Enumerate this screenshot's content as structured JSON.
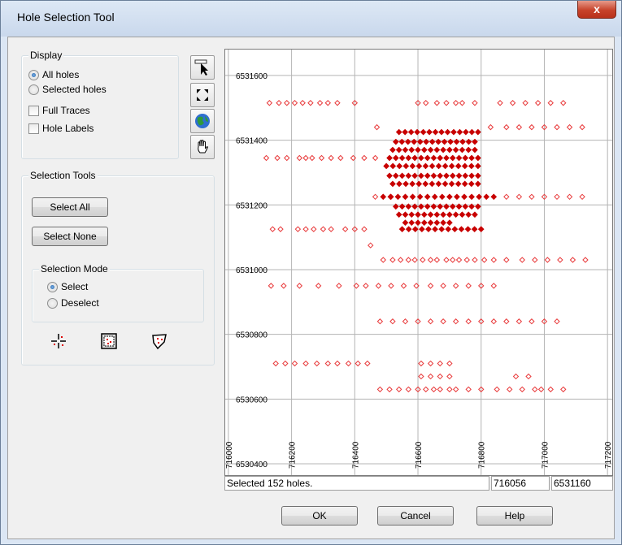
{
  "window": {
    "title": "Hole Selection Tool",
    "close_symbol": "x"
  },
  "display": {
    "title": "Display",
    "option_all": "All holes",
    "option_selected": "Selected holes",
    "selected_option": "All holes",
    "full_traces_label": "Full Traces",
    "full_traces_checked": false,
    "hole_labels_label": "Hole Labels",
    "hole_labels_checked": false
  },
  "toolbar": {
    "icons": [
      "pointer-icon",
      "zoom-extents-icon",
      "globe-icon",
      "pan-hand-icon"
    ]
  },
  "selection_tools": {
    "title": "Selection Tools",
    "select_all_label": "Select All",
    "select_none_label": "Select None",
    "mode_title": "Selection Mode",
    "mode_select": "Select",
    "mode_deselect": "Deselect",
    "mode_value": "Select",
    "icons": [
      "point-select-icon",
      "box-select-icon",
      "polygon-select-icon"
    ]
  },
  "chart_data": {
    "type": "scatter",
    "x_ticks": [
      "716000",
      "716200",
      "716400",
      "716600",
      "716800",
      "717000",
      "717200"
    ],
    "y_ticks": [
      "6531600",
      "6531400",
      "6531200",
      "6531000",
      "6530800",
      "6530600",
      "6530400"
    ],
    "xlim": [
      715990,
      717215
    ],
    "ylim": [
      6530365,
      6531680
    ],
    "grid": true,
    "colors": {
      "unselected": "#e8393a",
      "selected": "#c80000",
      "grid": "#b4b4b4"
    },
    "unselected_rows": [
      {
        "y": 6531515,
        "x": [
          716130,
          716160,
          716185,
          716210,
          716235,
          716260,
          716290,
          716315,
          716345,
          716400,
          716600,
          716625,
          716660,
          716690,
          716720,
          716740,
          716780,
          716860,
          716900,
          716940,
          716980,
          717020,
          717060
        ]
      },
      {
        "y": 6531440,
        "x": [
          716470,
          716830,
          716880,
          716920,
          716960,
          717000,
          717040,
          717080,
          717120
        ]
      },
      {
        "y": 6531345,
        "x": [
          716120,
          716155,
          716185,
          716225,
          716245,
          716265,
          716295,
          716325,
          716355,
          716395,
          716430,
          716465
        ]
      },
      {
        "y": 6531225,
        "x": [
          716465,
          716515,
          716880,
          716920,
          716960,
          717000,
          717040,
          717080,
          717120
        ]
      },
      {
        "y": 6531125,
        "x": [
          716140,
          716165,
          716220,
          716245,
          716270,
          716300,
          716325,
          716370,
          716400,
          716430
        ]
      },
      {
        "y": 6531075,
        "x": [
          716450
        ]
      },
      {
        "y": 6531030,
        "x": [
          716490,
          716520,
          716545,
          716570,
          716590,
          716615,
          716640,
          716660,
          716690,
          716710,
          716730,
          716755,
          716780,
          716810,
          716840,
          716880,
          716930,
          716970,
          717010,
          717050,
          717090,
          717130
        ]
      },
      {
        "y": 6530950,
        "x": [
          716135,
          716175,
          716225,
          716285,
          716350,
          716405,
          716435,
          716475,
          716515,
          716555,
          716595,
          716640,
          716680,
          716720,
          716760,
          716800,
          716840
        ]
      },
      {
        "y": 6530840,
        "x": [
          716480,
          716520,
          716560,
          716600,
          716640,
          716680,
          716720,
          716760,
          716800,
          716840,
          716880,
          716920,
          716960,
          717000,
          717040
        ]
      },
      {
        "y": 6530710,
        "x": [
          716150,
          716180,
          716210,
          716245,
          716280,
          716315,
          716345,
          716380,
          716410,
          716440,
          716610,
          716640,
          716670,
          716700
        ]
      },
      {
        "y": 6530670,
        "x": [
          716610,
          716640,
          716670,
          716700,
          716910,
          716950
        ]
      },
      {
        "y": 6530630,
        "x": [
          716480,
          716510,
          716540,
          716570,
          716600,
          716625,
          716650,
          716670,
          716700,
          716720,
          716760,
          716800,
          716850,
          716890,
          716930,
          716970,
          716990,
          717020,
          717060
        ]
      }
    ],
    "selected_rows": [
      {
        "y": 6531425,
        "x_from": 716540,
        "x_to": 716790,
        "count": 14
      },
      {
        "y": 6531395,
        "x_from": 716530,
        "x_to": 716780,
        "count": 14
      },
      {
        "y": 6531370,
        "x_from": 716520,
        "x_to": 716780,
        "count": 14
      },
      {
        "y": 6531345,
        "x_from": 716510,
        "x_to": 716790,
        "count": 15
      },
      {
        "y": 6531320,
        "x_from": 716500,
        "x_to": 716790,
        "count": 15
      },
      {
        "y": 6531290,
        "x_from": 716510,
        "x_to": 716790,
        "count": 15
      },
      {
        "y": 6531265,
        "x_from": 716520,
        "x_to": 716790,
        "count": 14
      },
      {
        "y": 6531225,
        "x_from": 716490,
        "x_to": 716840,
        "count": 16
      },
      {
        "y": 6531195,
        "x_from": 716530,
        "x_to": 716790,
        "count": 14
      },
      {
        "y": 6531170,
        "x_from": 716540,
        "x_to": 716780,
        "count": 13
      },
      {
        "y": 6531145,
        "x_from": 716560,
        "x_to": 716700,
        "count": 8
      },
      {
        "y": 6531125,
        "x_from": 716550,
        "x_to": 716800,
        "count": 13
      }
    ]
  },
  "status": {
    "message": "Selected 152 holes.",
    "x_coord": "716056",
    "y_coord": "6531160"
  },
  "footer": {
    "ok_label": "OK",
    "cancel_label": "Cancel",
    "help_label": "Help"
  }
}
